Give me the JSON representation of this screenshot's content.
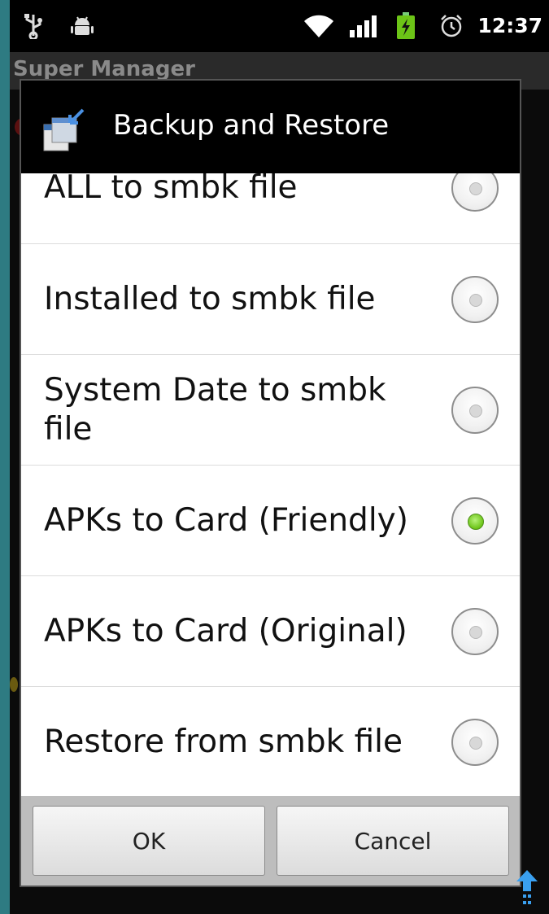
{
  "status_bar": {
    "time": "12:37",
    "icons": [
      "usb-icon",
      "android-debug-icon",
      "wifi-icon",
      "signal-icon",
      "battery-charging-icon",
      "alarm-icon"
    ]
  },
  "app": {
    "title": "Super Manager"
  },
  "dialog": {
    "title": "Backup and Restore",
    "icon": "backup-restore-icon",
    "options": [
      {
        "label": "ALL to smbk file",
        "selected": false
      },
      {
        "label": "Installed to smbk file",
        "selected": false
      },
      {
        "label": "System Date to smbk file",
        "selected": false
      },
      {
        "label": "APKs to Card (Friendly)",
        "selected": true
      },
      {
        "label": "APKs to Card (Original)",
        "selected": false
      },
      {
        "label": "Restore from smbk file",
        "selected": false
      }
    ],
    "buttons": {
      "ok": "OK",
      "cancel": "Cancel"
    }
  },
  "colors": {
    "accent_green": "#6cc417",
    "dialog_header": "#000000",
    "list_background": "#ffffff",
    "outer_background": "#2e7b82"
  }
}
